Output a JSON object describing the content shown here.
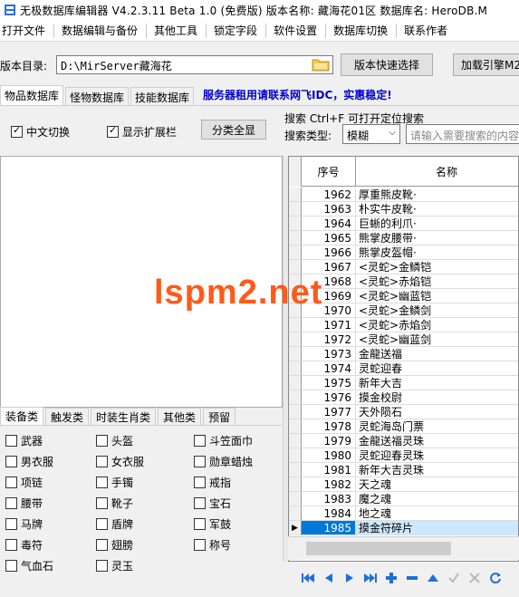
{
  "window": {
    "title": "无极数据库编辑器 V4.2.3.11    Beta 1.0 (免费版)     版本名称: 藏海花01区       数据库名: HeroDB.M"
  },
  "menu": {
    "items": [
      "打开文件",
      "数据编辑与备份",
      "其他工具",
      "锁定字段",
      "软件设置",
      "数据库切换",
      "联系作者"
    ]
  },
  "dir": {
    "label": "版本目录:",
    "path": "D:\\MirServer藏海花",
    "quick_select": "版本快速选择",
    "load_engine": "加载引擎M2"
  },
  "top_tabs": [
    "物品数据库",
    "怪物数据库",
    "技能数据库"
  ],
  "ad_text": "服务器租用请联系网飞IDC，实惠稳定!",
  "options": {
    "chinese_switch": "中文切换",
    "show_extension": "显示扩展栏",
    "classify_all": "分类全显"
  },
  "search": {
    "title": "搜索   Ctrl+F 可打开定位搜索",
    "type_label": "搜索类型:",
    "type_value": "模糊",
    "placeholder": "请输入需要搜索的内容"
  },
  "grid": {
    "col_id": "序号",
    "col_name": "名称",
    "rows": [
      {
        "id": "1962",
        "name": "厚重熊皮靴·"
      },
      {
        "id": "1963",
        "name": "朴实牛皮靴·"
      },
      {
        "id": "1964",
        "name": "巨蜥的利爪·"
      },
      {
        "id": "1965",
        "name": "熊掌皮腰带·"
      },
      {
        "id": "1966",
        "name": "熊掌皮盔帽·"
      },
      {
        "id": "1967",
        "name": "<灵蛇>金鳞铠"
      },
      {
        "id": "1968",
        "name": "<灵蛇>赤焰铠"
      },
      {
        "id": "1969",
        "name": "<灵蛇>幽蓝铠"
      },
      {
        "id": "1970",
        "name": "<灵蛇>金鳞剑"
      },
      {
        "id": "1971",
        "name": "<灵蛇>赤焰剑"
      },
      {
        "id": "1972",
        "name": "<灵蛇>幽蓝剑"
      },
      {
        "id": "1973",
        "name": "金龍送福"
      },
      {
        "id": "1974",
        "name": "灵蛇迎春"
      },
      {
        "id": "1975",
        "name": "新年大吉"
      },
      {
        "id": "1976",
        "name": "摸金校尉"
      },
      {
        "id": "1977",
        "name": "天外陨石"
      },
      {
        "id": "1978",
        "name": "灵蛇海岛门票"
      },
      {
        "id": "1979",
        "name": "金龍送福灵珠"
      },
      {
        "id": "1980",
        "name": "灵蛇迎春灵珠"
      },
      {
        "id": "1981",
        "name": "新年大吉灵珠"
      },
      {
        "id": "1982",
        "name": "天之魂"
      },
      {
        "id": "1983",
        "name": "魔之魂"
      },
      {
        "id": "1984",
        "name": "地之魂"
      },
      {
        "id": "1985",
        "name": "摸金符碎片"
      }
    ]
  },
  "bottom_tabs": [
    "装备类",
    "触发类",
    "时装生肖类",
    "其他类",
    "预留"
  ],
  "categories": [
    "武器",
    "头盔",
    "斗笠面巾",
    "男衣服",
    "女衣服",
    "勋章蜡烛",
    "项链",
    "手镯",
    "戒指",
    "腰带",
    "靴子",
    "宝石",
    "马牌",
    "盾牌",
    "军鼓",
    "毒符",
    "翅膀",
    "称号",
    "气血石",
    "灵玉"
  ],
  "watermark": "lspm2.net",
  "colors": {
    "accent": "#0078d7",
    "ad_text": "#0000d0",
    "nav_icons": "#1e6fd9",
    "watermark": "#ff5a1a"
  },
  "nav_icons": [
    "first-icon",
    "prev-icon",
    "next-icon",
    "last-icon",
    "insert-icon",
    "delete-icon",
    "edit-icon",
    "post-icon",
    "cancel-icon",
    "refresh-icon"
  ]
}
